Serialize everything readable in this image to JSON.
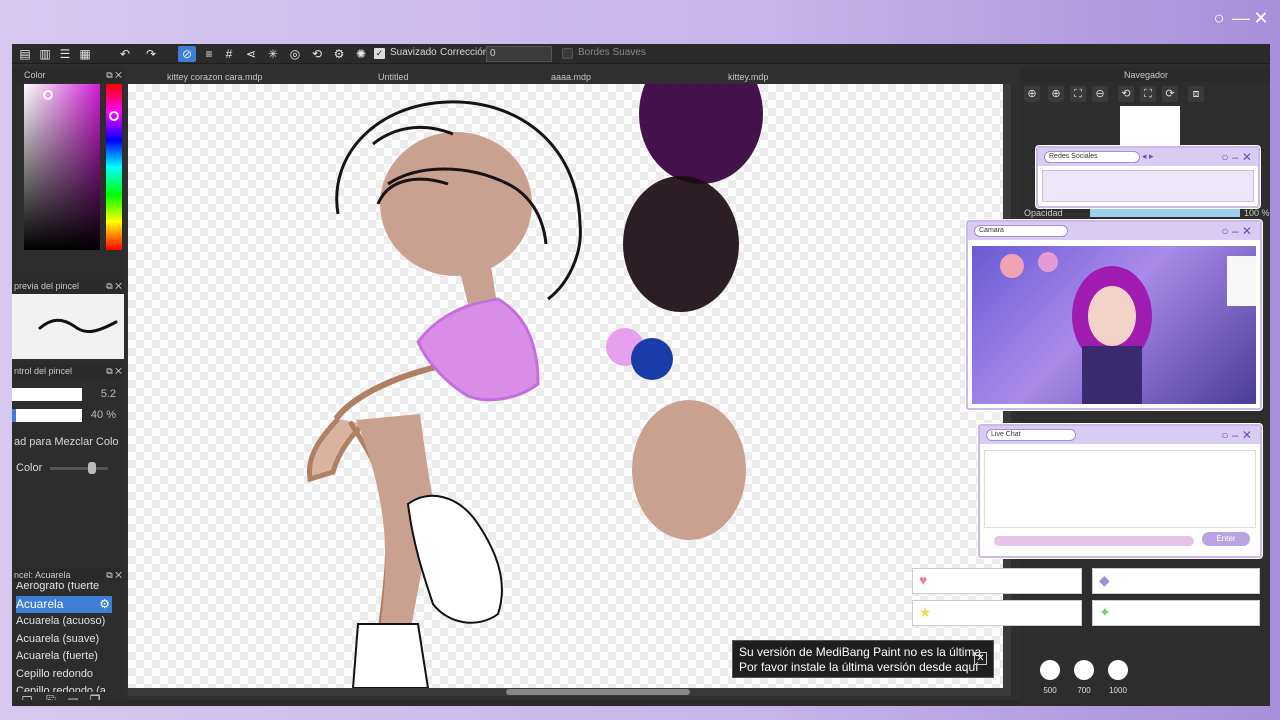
{
  "toolbar": {
    "smoothing_label": "Suavizado",
    "correction_label": "Corrección",
    "correction_value": "0",
    "soft_edges_label": "Bordes Suaves"
  },
  "left_panel": {
    "color_title": "Color",
    "brush_preview_title": "previa del pincel",
    "brush_control_title": "ntrol del pincel",
    "brush_size": "5.2",
    "brush_opacity": "40 %",
    "mix_label": "ad para Mezclar Colo",
    "color_label": "Color",
    "brush_panel_title": "ncel: Acuarela",
    "brushes": [
      "Aerógrafo (fuerte",
      "Acuarela",
      "Acuarela (acuoso)",
      "Acuarela (suave)",
      "Acuarela (fuerte)",
      "Cepillo redondo",
      "Cepillo redondo (a"
    ]
  },
  "tabs": [
    "kittey corazon cara.mdp",
    "Untitled",
    "aaaa.mdp",
    "kittey.mdp"
  ],
  "right_panel": {
    "navigator_title": "Navegador",
    "opacity_label": "Opacidad",
    "opacity_value": "100 %",
    "size_labels": [
      "500",
      "700",
      "1000"
    ]
  },
  "overlay": {
    "social_title": "Redes Sociales",
    "camera_title": "Camara",
    "chat_title": "Live Chat",
    "enter_label": "Enter"
  },
  "notification": {
    "line1": "Su versión de MediBang Paint no es la última",
    "line2": "Por favor instale la última versión desde aquí"
  },
  "colors": {
    "selected_color": "#d01ed5",
    "accent": "#3d7fd6",
    "frame": "#c7b4ea"
  }
}
